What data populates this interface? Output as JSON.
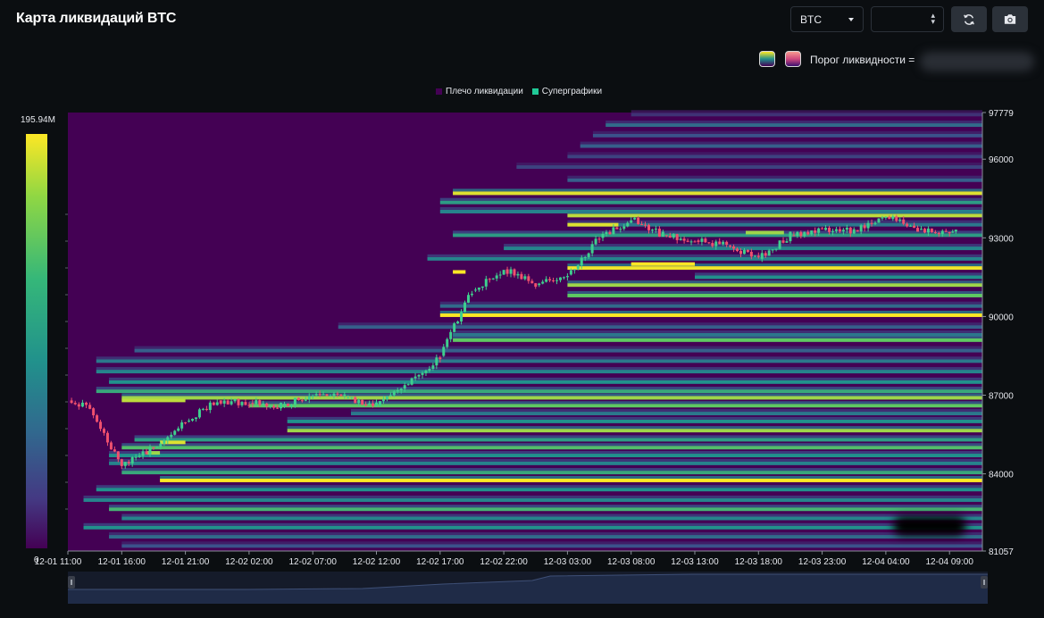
{
  "header": {
    "title": "Карта ликвидаций BTC",
    "coin_value": "BTC",
    "period_value": ""
  },
  "controls": {
    "refresh_icon": "refresh-icon",
    "camera_icon": "camera-icon",
    "threshold_label": "Порог ликвидности ="
  },
  "legend": {
    "items": [
      {
        "label": "Плечо ликвидации",
        "color": "#440154"
      },
      {
        "label": "Суперграфики",
        "color": "#20c997"
      }
    ]
  },
  "colorbar": {
    "max_label": "195.94M",
    "min_label": "0",
    "colors": [
      "#fde725",
      "#35b779",
      "#21918c",
      "#31688e",
      "#440154"
    ]
  },
  "chart_data": {
    "type": "heatmap",
    "title": "",
    "ylim": [
      81057,
      97779
    ],
    "y_ticks": [
      "97779",
      "96000",
      "93000",
      "90000",
      "87000",
      "84000",
      "81057"
    ],
    "x_ticks": [
      "12-01 11:00",
      "12-01 16:00",
      "12-01 21:00",
      "12-02 02:00",
      "12-02 07:00",
      "12-02 12:00",
      "12-02 17:00",
      "12-02 22:00",
      "12-03 03:00",
      "12-03 08:00",
      "12-03 13:00",
      "12-03 18:00",
      "12-03 23:00",
      "12-04 04:00",
      "12-04 09:00"
    ],
    "background_color": "#440154",
    "price_series": {
      "name": "",
      "times": [
        "12-01 11:00",
        "12-01 13:30",
        "12-01 16:00",
        "12-01 18:30",
        "12-01 21:00",
        "12-01 23:30",
        "12-02 02:00",
        "12-02 04:30",
        "12-02 07:00",
        "12-02 09:30",
        "12-02 12:00",
        "12-02 14:30",
        "12-02 17:00",
        "12-02 19:30",
        "12-02 22:00",
        "12-03 00:30",
        "12-03 03:00",
        "12-03 05:30",
        "12-03 08:00",
        "12-03 10:30",
        "12-03 13:00",
        "12-03 15:30",
        "12-03 18:00",
        "12-03 20:30",
        "12-03 23:00",
        "12-04 01:30",
        "12-04 04:00",
        "12-04 06:30",
        "12-04 09:00",
        "12-04 09:30"
      ],
      "values": [
        86800,
        86500,
        84300,
        85000,
        86000,
        86800,
        86700,
        86600,
        87000,
        86900,
        86600,
        87400,
        88500,
        91000,
        91800,
        91200,
        91600,
        93000,
        93700,
        93100,
        92900,
        92700,
        92200,
        93100,
        93300,
        93300,
        93800,
        93300,
        93200,
        93200
      ]
    },
    "liquidation_bands": [
      {
        "price": 97700,
        "start": "12-03 08:00",
        "intensity": 0.15
      },
      {
        "price": 97300,
        "start": "12-03 06:00",
        "intensity": 0.35
      },
      {
        "price": 96900,
        "start": "12-03 05:00",
        "intensity": 0.25
      },
      {
        "price": 96500,
        "start": "12-03 04:00",
        "intensity": 0.3
      },
      {
        "price": 96100,
        "start": "12-03 03:00",
        "intensity": 0.2
      },
      {
        "price": 95700,
        "start": "12-02 23:00",
        "intensity": 0.2
      },
      {
        "price": 95200,
        "start": "12-03 03:00",
        "intensity": 0.3
      },
      {
        "price": 94700,
        "start": "12-02 18:00",
        "intensity": 0.95
      },
      {
        "price": 94350,
        "start": "12-02 17:00",
        "intensity": 0.55
      },
      {
        "price": 94000,
        "start": "12-02 17:00",
        "intensity": 0.45
      },
      {
        "price": 93850,
        "start": "12-03 03:00",
        "intensity": 0.9
      },
      {
        "price": 93500,
        "start": "12-03 03:00",
        "intensity": 0.4
      },
      {
        "price": 93100,
        "start": "12-02 18:00",
        "intensity": 0.55
      },
      {
        "price": 92600,
        "start": "12-02 22:00",
        "intensity": 0.45
      },
      {
        "price": 92200,
        "start": "12-02 16:00",
        "intensity": 0.45
      },
      {
        "price": 91850,
        "start": "12-03 03:00",
        "intensity": 0.98
      },
      {
        "price": 91500,
        "start": "12-03 13:00",
        "intensity": 0.5
      },
      {
        "price": 91200,
        "start": "12-03 03:00",
        "intensity": 0.85
      },
      {
        "price": 90800,
        "start": "12-03 03:00",
        "intensity": 0.75
      },
      {
        "price": 90400,
        "start": "12-02 17:00",
        "intensity": 0.35
      },
      {
        "price": 90050,
        "start": "12-02 17:00",
        "intensity": 1.0
      },
      {
        "price": 89600,
        "start": "12-02 09:00",
        "intensity": 0.3
      },
      {
        "price": 89300,
        "start": "12-02 18:00",
        "intensity": 0.4
      },
      {
        "price": 89100,
        "start": "12-02 18:00",
        "intensity": 0.75
      },
      {
        "price": 88700,
        "start": "12-01 17:00",
        "intensity": 0.3
      },
      {
        "price": 88300,
        "start": "12-01 14:00",
        "intensity": 0.4
      },
      {
        "price": 87900,
        "start": "12-01 14:00",
        "intensity": 0.45
      },
      {
        "price": 87500,
        "start": "12-01 15:00",
        "intensity": 0.5
      },
      {
        "price": 87150,
        "start": "12-01 14:00",
        "intensity": 0.6
      },
      {
        "price": 86900,
        "start": "12-01 16:00",
        "intensity": 0.85
      },
      {
        "price": 86600,
        "start": "12-02 02:00",
        "intensity": 0.75
      },
      {
        "price": 86300,
        "start": "12-02 10:00",
        "intensity": 0.4
      },
      {
        "price": 86000,
        "start": "12-02 05:00",
        "intensity": 0.5
      },
      {
        "price": 85650,
        "start": "12-02 05:00",
        "intensity": 0.85
      },
      {
        "price": 85300,
        "start": "12-01 17:00",
        "intensity": 0.55
      },
      {
        "price": 85000,
        "start": "12-01 16:00",
        "intensity": 0.7
      },
      {
        "price": 84700,
        "start": "12-01 15:00",
        "intensity": 0.5
      },
      {
        "price": 84400,
        "start": "12-01 15:00",
        "intensity": 0.45
      },
      {
        "price": 84050,
        "start": "12-01 16:00",
        "intensity": 0.6
      },
      {
        "price": 83750,
        "start": "12-01 19:00",
        "intensity": 1.0
      },
      {
        "price": 83400,
        "start": "12-01 14:00",
        "intensity": 0.5
      },
      {
        "price": 83000,
        "start": "12-01 13:00",
        "intensity": 0.45
      },
      {
        "price": 82650,
        "start": "12-01 15:00",
        "intensity": 0.65
      },
      {
        "price": 82300,
        "start": "12-01 16:00",
        "intensity": 0.45
      },
      {
        "price": 81950,
        "start": "12-01 13:00",
        "intensity": 0.5
      },
      {
        "price": 81600,
        "start": "12-01 15:00",
        "intensity": 0.35
      },
      {
        "price": 81250,
        "start": "12-01 16:00",
        "intensity": 0.25
      }
    ],
    "short_bands": [
      {
        "price": 86800,
        "start": "12-01 16:00",
        "end": "12-01 21:00",
        "intensity": 0.9
      },
      {
        "price": 85200,
        "start": "12-01 19:00",
        "end": "12-01 21:00",
        "intensity": 0.95
      },
      {
        "price": 84800,
        "start": "12-01 18:00",
        "end": "12-01 19:00",
        "intensity": 0.85
      },
      {
        "price": 93500,
        "start": "12-03 03:00",
        "end": "12-03 07:00",
        "intensity": 0.95
      },
      {
        "price": 92000,
        "start": "12-03 08:00",
        "end": "12-03 13:00",
        "intensity": 1.0
      },
      {
        "price": 91700,
        "start": "12-02 18:00",
        "end": "12-02 19:00",
        "intensity": 1.0
      },
      {
        "price": 93200,
        "start": "12-03 17:00",
        "end": "12-03 20:00",
        "intensity": 0.85
      }
    ]
  },
  "navigator": {
    "handle_left_icon": "drag-handle-icon",
    "handle_right_icon": "drag-handle-icon"
  }
}
